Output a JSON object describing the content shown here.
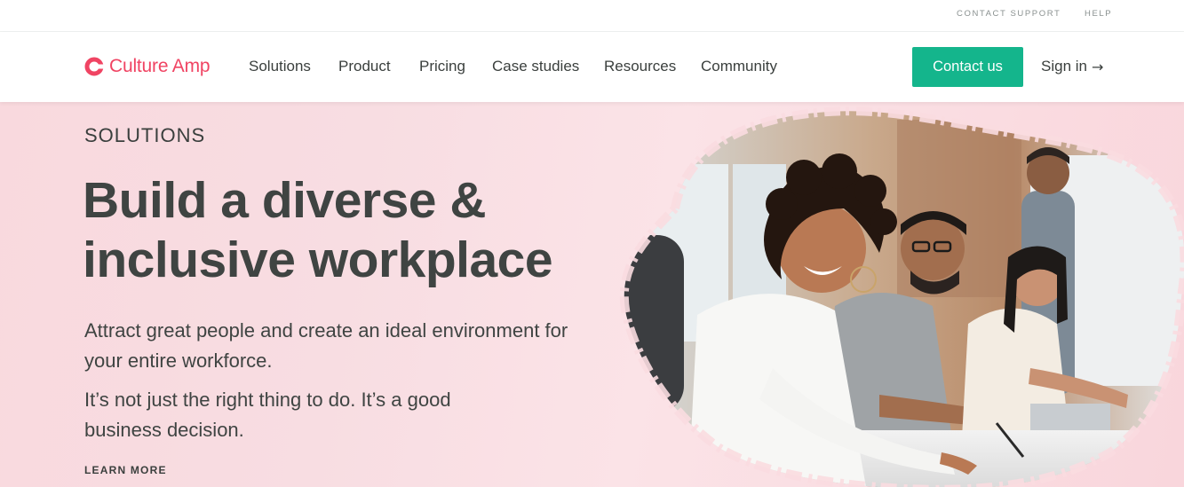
{
  "utility": {
    "contact_support": "CONTACT SUPPORT",
    "help": "HELP"
  },
  "nav": {
    "logo_text": "Culture Amp",
    "items": [
      "Solutions",
      "Product",
      "Pricing",
      "Case studies",
      "Resources",
      "Community"
    ],
    "contact_button": "Contact us",
    "sign_in": "Sign in",
    "sign_in_arrow": "→"
  },
  "hero": {
    "eyebrow": "SOLUTIONS",
    "title": "Build a diverse & inclusive workplace",
    "body": "Attract great people and create an ideal environment for your entire workforce.",
    "body2": "It’s not just the right thing to do. It’s a good business decision.",
    "learn_more": "LEARN MORE"
  },
  "colors": {
    "brand": "#f04463",
    "accent": "#14b58c",
    "hero_bg": "#f9dbe0",
    "text": "#3f4442"
  },
  "icons": {
    "logo": "culture-amp-logo-icon",
    "arrow": "arrow-right-icon"
  }
}
